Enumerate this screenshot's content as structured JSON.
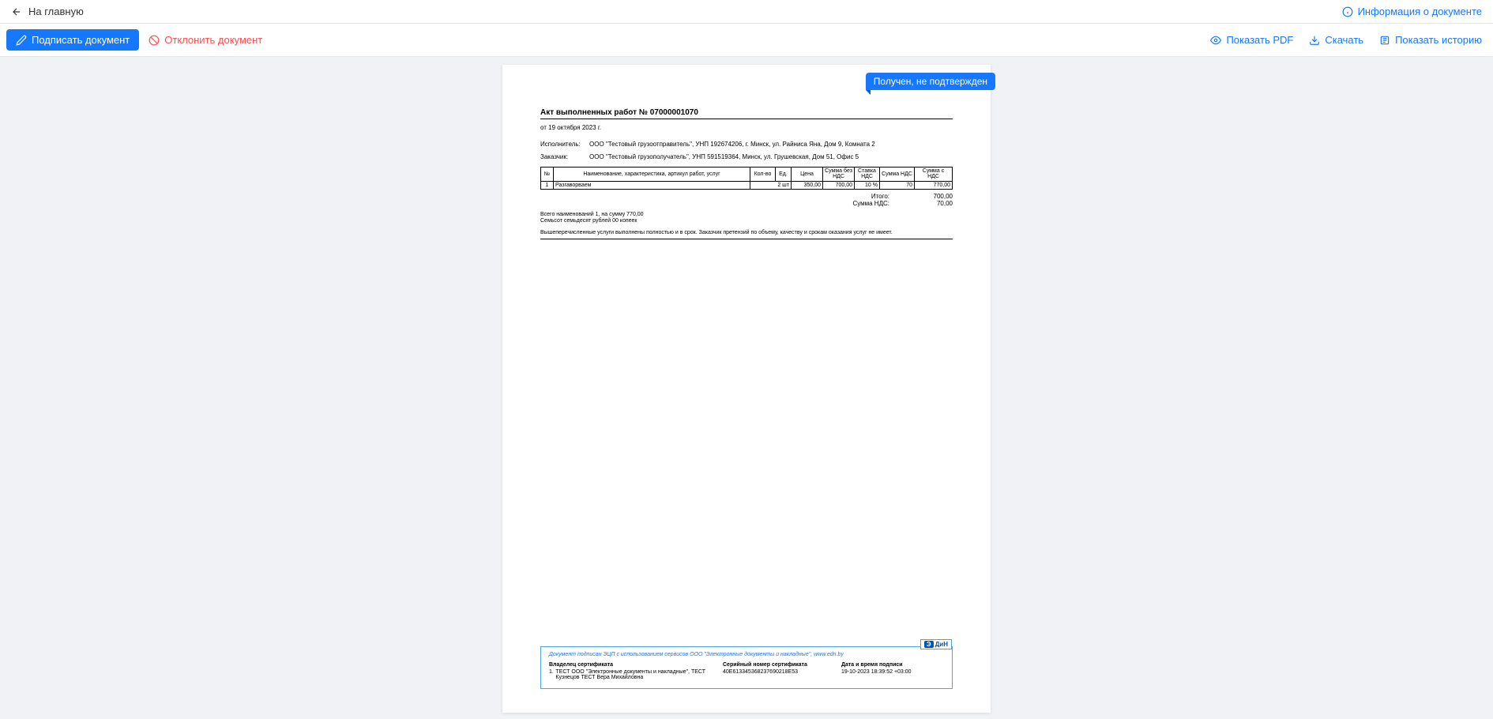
{
  "header": {
    "back": "На главную",
    "info": "Информация о документе"
  },
  "toolbar": {
    "sign": "Подписать документ",
    "reject": "Отклонить документ",
    "showPdf": "Показать PDF",
    "download": "Скачать",
    "history": "Показать историю"
  },
  "status": "Получен, не подтвержден",
  "doc": {
    "title": "Акт выполненных работ № 07000001070",
    "date": "от 19 октября 2023 г.",
    "executorLabel": "Исполнитель:",
    "executor": "ООО \"Тестовый грузоотправитель\", УНП 192674206, г. Минск, ул. Райниса Яна, Дом 9, Комната 2",
    "customerLabel": "Заказчик:",
    "customer": "ООО \"Тестовый грузополучатель\", УНП 591519364, Минск, ул. Грушевская, Дом 51, Офис 5",
    "table": {
      "h_num": "№",
      "h_name": "Наименование, характеристика, артикул работ, услуг",
      "h_qty": "Кол-во",
      "h_unit": "Ед.",
      "h_price": "Цена",
      "h_sumNoVat": "Сумма без НДС",
      "h_vatRate": "Ставка НДС",
      "h_vatSum": "Сумма НДС",
      "h_total": "Сумма с НДС",
      "r_num": "1",
      "r_name": "Разгаворваем",
      "r_qty": "2 шт",
      "r_price": "350,00",
      "r_sumNoVat": "700,00",
      "r_vatRate": "10 %",
      "r_vatSum": "70",
      "r_total": "770,00"
    },
    "totals": {
      "itogoLabel": "Итого:",
      "itogo": "700,00",
      "vatLabel": "Сумма НДС:",
      "vat": "70,00"
    },
    "note1": "Всего наименований 1, на сумму 770,00",
    "note2": "Семьсот семьдесят рублей 00 копеек",
    "note3": "Вышеперечисленные услуги выполнены полностью и в срок. Заказчик претензий по объему, качеству и срокам оказания услуг не имеет."
  },
  "signature": {
    "header": "Документ подписан ЭЦП с использованием сервисов ООО \"Электронные документы и накладные\", www.edn.by",
    "logo": "ДиН",
    "col1Head": "Владелец сертификата",
    "col2Head": "Серийный номер сертификата",
    "col3Head": "Дата и время подписи",
    "rowNum": "1.",
    "owner": "ТЕСТ ООО \"Электронные документы и накладные\", ТЕСТ Кузнецов ТЕСТ Вера Михайловна",
    "serial": "40E613345368237690218E53",
    "datetime": "19-10-2023 18:39:52 +03:00"
  }
}
